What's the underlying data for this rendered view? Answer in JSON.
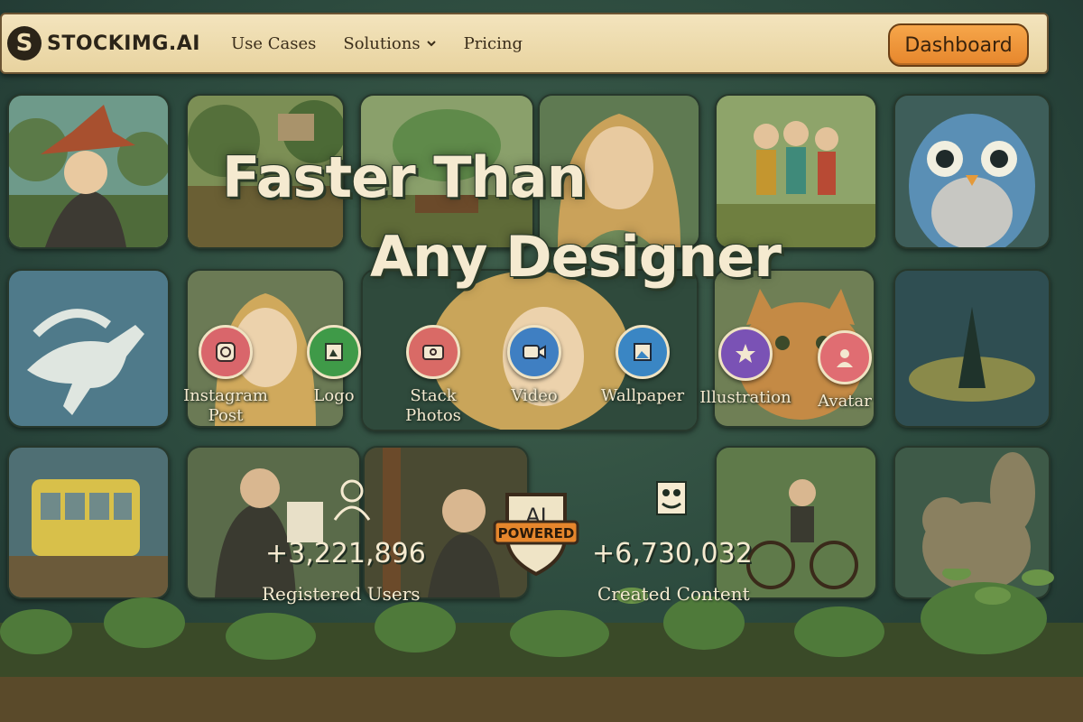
{
  "nav": {
    "logo_letter": "S",
    "brand": "STOCKIMG.AI",
    "links": [
      {
        "label": "Use Cases"
      },
      {
        "label": "Solutions",
        "has_dropdown": true
      },
      {
        "label": "Pricing"
      }
    ],
    "dashboard_label": "Dashboard"
  },
  "hero": {
    "line1": "Faster Than",
    "line2": "Any Designer"
  },
  "categories": [
    {
      "label": "Instagram Post",
      "line1": "Instagram",
      "line2": "Post",
      "color": "#d9666b",
      "icon": "instagram-icon"
    },
    {
      "label": "Logo",
      "line1": "Logo",
      "line2": "",
      "color": "#3f9a48",
      "icon": "logo-icon"
    },
    {
      "label": "Stack Photos",
      "line1": "Stack",
      "line2": "Photos",
      "color": "#d96a66",
      "icon": "photo-icon"
    },
    {
      "label": "Video",
      "line1": "Video",
      "line2": "",
      "color": "#3f7fc2",
      "icon": "video-icon"
    },
    {
      "label": "Wallpaper",
      "line1": "Wallpaper",
      "line2": "",
      "color": "#3a86c4",
      "icon": "wallpaper-icon"
    },
    {
      "label": "Illustration",
      "line1": "Illustration",
      "line2": "",
      "color": "#7a52b5",
      "icon": "star-icon"
    },
    {
      "label": "Avatar",
      "line1": "Avatar",
      "line2": "",
      "color": "#e06d72",
      "icon": "avatar-icon"
    }
  ],
  "stats": {
    "users_count": "+3,221,896",
    "users_label": "Registered Users",
    "content_count": "+6,730,032",
    "content_label": "Created Content"
  },
  "badge": {
    "top": "AI",
    "ribbon": "POWERED"
  },
  "colors": {
    "accent": "#e6862c",
    "nav_bg": "#efdcae",
    "cream_text": "#f5ead0",
    "forest": "#2c4a3e"
  }
}
